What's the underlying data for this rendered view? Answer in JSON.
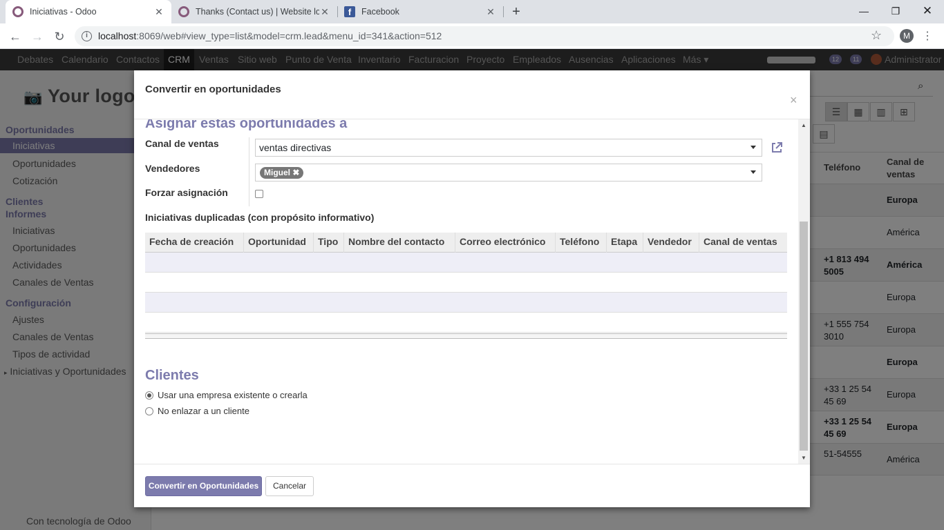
{
  "browser": {
    "tabs": [
      {
        "title": "Iniciativas - Odoo",
        "icon": "odoo-icon"
      },
      {
        "title": "Thanks (Contact us) | Website loc",
        "icon": "odoo-icon"
      },
      {
        "title": "Facebook",
        "icon": "facebook-icon"
      }
    ],
    "url_host": "localhost",
    "url_rest": ":8069/web#view_type=list&model=crm.lead&menu_id=341&action=512",
    "profile_initial": "M"
  },
  "topmenu": {
    "items": [
      "Debates",
      "Calendario",
      "Contactos",
      "CRM",
      "Ventas",
      "Sitio web",
      "Punto de Venta",
      "Inventario",
      "Facturacion",
      "Proyecto",
      "Empleados",
      "Ausencias",
      "Aplicaciones",
      "Más"
    ],
    "active": "CRM",
    "badge_messages": "12",
    "badge_activities": "11",
    "user": "Administrator"
  },
  "sidebar": {
    "logo": "Your logo",
    "groups": [
      {
        "title": "Oportunidades",
        "items": [
          "Iniciativas",
          "Oportunidades",
          "Cotización"
        ]
      },
      {
        "title": "Clientes",
        "items": []
      },
      {
        "title": "Informes",
        "items": [
          "Iniciativas",
          "Oportunidades",
          "Actividades",
          "Canales de Ventas"
        ]
      },
      {
        "title": "Configuración",
        "items": [
          "Ajustes",
          "Canales de Ventas",
          "Tipos de actividad",
          "Iniciativas y Oportunidades"
        ]
      }
    ],
    "footer": "Con tecnología de Odoo"
  },
  "bg_list": {
    "headers": [
      "Teléfono",
      "Canal de ventas"
    ],
    "rows": [
      {
        "tel": "",
        "canal": "Europa"
      },
      {
        "tel": "",
        "canal": "América"
      },
      {
        "tel": "+1 813 494 5005",
        "canal": "América"
      },
      {
        "tel": "",
        "canal": "Europa"
      },
      {
        "tel": "+1 555 754 3010",
        "canal": "Europa"
      },
      {
        "tel": "",
        "canal": "Europa"
      },
      {
        "tel": "+33 1 25 54 45 69",
        "canal": "Europa"
      },
      {
        "tel": "+33 1 25 54 45 69",
        "canal": "Europa"
      },
      {
        "tel": "51-54555",
        "canal": "América"
      }
    ]
  },
  "modal": {
    "title": "Convertir en oportunidades",
    "close": "×",
    "assign_title": "Asignar estas oportunidades a",
    "fields": {
      "canal_label": "Canal de ventas",
      "canal_value": "ventas directivas",
      "vendedores_label": "Vendedores",
      "vendedores_tag": "Miguel",
      "forzar_label": "Forzar asignación"
    },
    "dup_title": "Iniciativas duplicadas (con propósito informativo)",
    "dup_columns": [
      "Fecha de creación",
      "Oportunidad",
      "Tipo",
      "Nombre del contacto",
      "Correo electrónico",
      "Teléfono",
      "Etapa",
      "Vendedor",
      "Canal de ventas"
    ],
    "clientes_title": "Clientes",
    "radio_options": [
      "Usar una empresa existente o crearla",
      "No enlazar a un cliente"
    ],
    "btn_convert": "Convertir en Oportunidades",
    "btn_cancel": "Cancelar"
  }
}
